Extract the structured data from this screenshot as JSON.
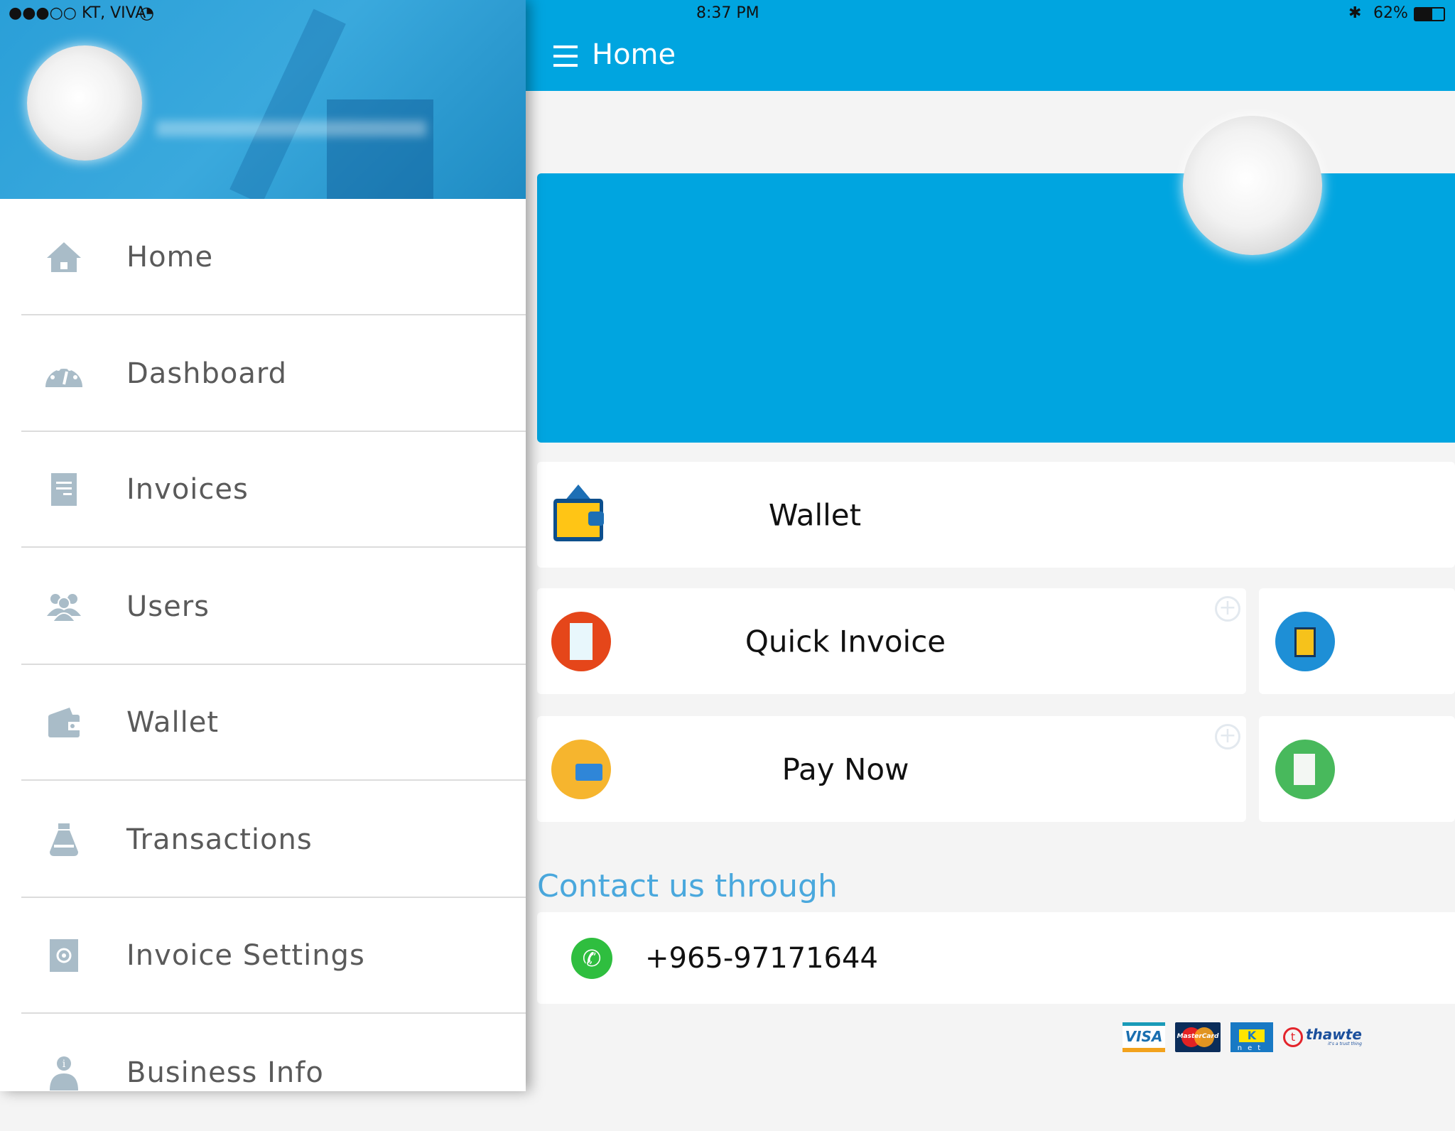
{
  "status_bar": {
    "carrier": "●●●○○ KT, VIVA",
    "time": "8:37 PM",
    "battery": "62%"
  },
  "header": {
    "title": "Home",
    "menu_icon": "hamburger-icon"
  },
  "drawer": {
    "items": [
      {
        "label": "Home",
        "icon": "home-icon"
      },
      {
        "label": "Dashboard",
        "icon": "dashboard-icon"
      },
      {
        "label": "Invoices",
        "icon": "invoice-icon"
      },
      {
        "label": "Users",
        "icon": "users-icon"
      },
      {
        "label": "Wallet",
        "icon": "wallet-icon"
      },
      {
        "label": "Transactions",
        "icon": "money-bag-icon"
      },
      {
        "label": "Invoice Settings",
        "icon": "settings-icon"
      },
      {
        "label": "Business Info",
        "icon": "business-info-icon"
      }
    ],
    "icon_color": "#a9bcc8"
  },
  "cards": {
    "wallet": "Wallet",
    "quick_invoice": "Quick Invoice",
    "pay_now": "Pay Now"
  },
  "contact": {
    "title": "Contact us through",
    "phone": "+965-97171644"
  },
  "payment_logos": {
    "visa": "VISA",
    "mastercard": "MasterCard",
    "knet": "net",
    "thawte": "thawte",
    "thawte_tagline": "it's a trust thing"
  },
  "colors": {
    "brand": "#00a5e0",
    "contact_title": "#4aa8dd"
  }
}
